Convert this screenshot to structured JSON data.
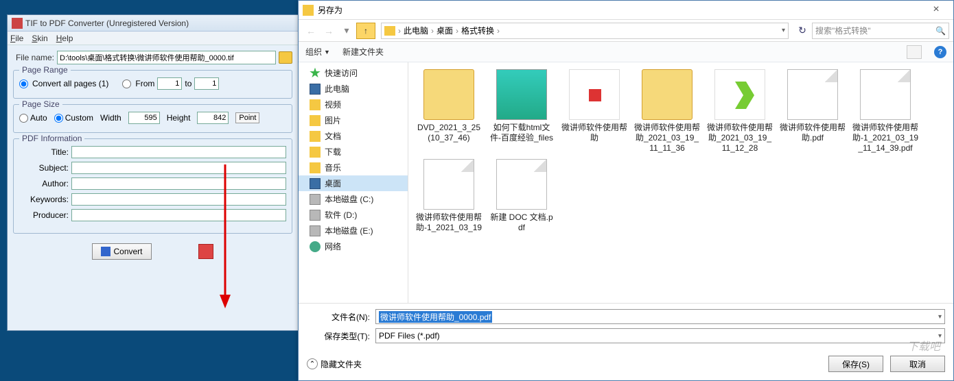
{
  "converter": {
    "title": "TIF to PDF Converter (Unregistered Version)",
    "menu": {
      "file": "File",
      "skin": "Skin",
      "help": "Help"
    },
    "file_label": "File name:",
    "file_value": "D:\\tools\\桌面\\格式转换\\微讲师软件使用帮助_0000.tif",
    "page_range": {
      "legend": "Page Range",
      "all_label": "Convert all pages (1)",
      "from_label": "From",
      "from_value": "1",
      "to_label": "to",
      "to_value": "1"
    },
    "page_size": {
      "legend": "Page Size",
      "auto_label": "Auto",
      "custom_label": "Custom",
      "width_label": "Width",
      "width_value": "595",
      "height_label": "Height",
      "height_value": "842",
      "unit": "Point"
    },
    "pdf_info": {
      "legend": "PDF Information",
      "title": "Title:",
      "subject": "Subject:",
      "author": "Author:",
      "keywords": "Keywords:",
      "producer": "Producer:"
    },
    "convert_label": "Convert"
  },
  "saveas": {
    "title": "另存为",
    "breadcrumb": {
      "pc": "此电脑",
      "desktop": "桌面",
      "folder": "格式转换"
    },
    "search_placeholder": "搜索\"格式转换\"",
    "toolbar": {
      "organize": "组织",
      "new_folder": "新建文件夹"
    },
    "sidebar": [
      {
        "label": "快速访问",
        "icon": "star"
      },
      {
        "label": "此电脑",
        "icon": "monitor"
      },
      {
        "label": "视频",
        "icon": "folder"
      },
      {
        "label": "图片",
        "icon": "folder"
      },
      {
        "label": "文档",
        "icon": "folder"
      },
      {
        "label": "下载",
        "icon": "folder"
      },
      {
        "label": "音乐",
        "icon": "folder"
      },
      {
        "label": "桌面",
        "icon": "monitor",
        "selected": true
      },
      {
        "label": "本地磁盘 (C:)",
        "icon": "drive"
      },
      {
        "label": "软件 (D:)",
        "icon": "drive"
      },
      {
        "label": "本地磁盘 (E:)",
        "icon": "drive"
      },
      {
        "label": "网络",
        "icon": "net"
      }
    ],
    "files": [
      {
        "name": "DVD_2021_3_25(10_37_46)",
        "thumb": "folder"
      },
      {
        "name": "如何下载html文件-百度经验_files",
        "thumb": "html"
      },
      {
        "name": "微讲师软件使用帮助",
        "thumb": "red"
      },
      {
        "name": "微讲师软件使用帮助_2021_03_19_11_11_36",
        "thumb": "folder"
      },
      {
        "name": "微讲师软件使用帮助_2021_03_19_11_12_28",
        "thumb": "green"
      },
      {
        "name": "微讲师软件使用帮助.pdf",
        "thumb": "page"
      },
      {
        "name": "微讲师软件使用帮助-1_2021_03_19_11_14_39.pdf",
        "thumb": "page"
      },
      {
        "name": "微讲师软件使用帮助-1_2021_03_19",
        "thumb": "page"
      },
      {
        "name": "新建 DOC 文档.pdf",
        "thumb": "page"
      }
    ],
    "filename_label": "文件名(N):",
    "filename_value": "微讲师软件使用帮助_0000.pdf",
    "filetype_label": "保存类型(T):",
    "filetype_value": "PDF Files (*.pdf)",
    "hide_folders": "隐藏文件夹",
    "save_btn": "保存(S)",
    "cancel_btn": "取消"
  },
  "watermark": "下载吧"
}
